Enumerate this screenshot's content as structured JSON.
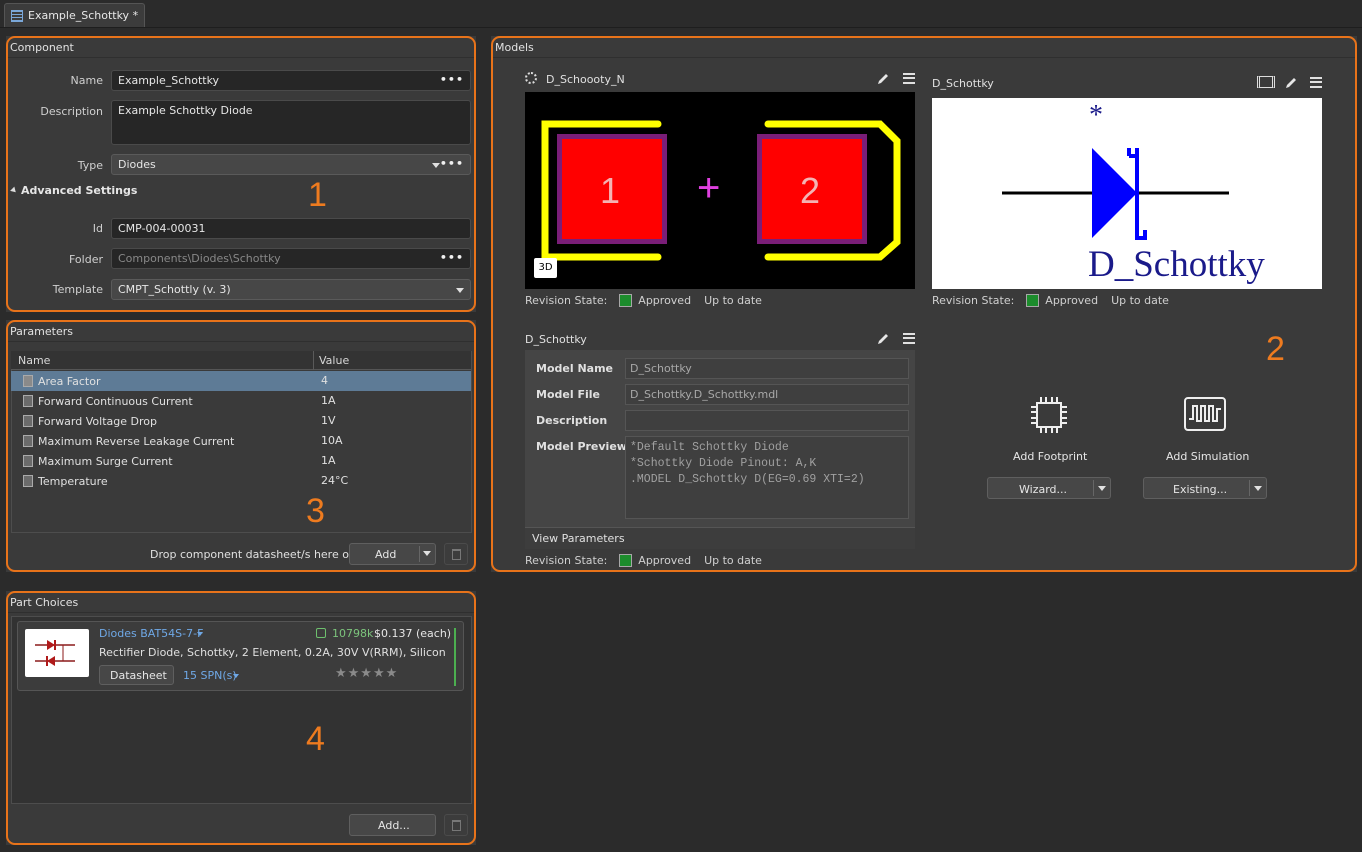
{
  "tab": {
    "title": "Example_Schottky *"
  },
  "component": {
    "title": "Component",
    "name_label": "Name",
    "name_value": "Example_Schottky",
    "description_label": "Description",
    "description_value": "Example Schottky Diode",
    "type_label": "Type",
    "type_value": "Diodes",
    "advanced_label": "Advanced Settings",
    "id_label": "Id",
    "id_value": "CMP-004-00031",
    "folder_label": "Folder",
    "folder_value": "Components\\Diodes\\Schottky",
    "template_label": "Template",
    "template_value": "CMPT_Schottly (v. 3)",
    "more": "•••"
  },
  "parameters": {
    "title": "Parameters",
    "columns": [
      "Name",
      "Value"
    ],
    "rows": [
      {
        "name": "Area Factor",
        "value": "4",
        "selected": true
      },
      {
        "name": "Forward Continuous Current",
        "value": "1A"
      },
      {
        "name": "Forward Voltage Drop",
        "value": "1V"
      },
      {
        "name": "Maximum Reverse Leakage Current",
        "value": "10A"
      },
      {
        "name": "Maximum Surge Current",
        "value": "1A"
      },
      {
        "name": "Temperature",
        "value": "24°C"
      }
    ],
    "drop_text": "Drop component datasheet/s here or",
    "add_label": "Add"
  },
  "part_choices": {
    "title": "Part Choices",
    "part_name": "Diodes BAT54S-7-F",
    "stock": "10798k",
    "price": "$0.137 (each)",
    "description": "Rectifier Diode, Schottky, 2 Element, 0.2A, 30V V(RRM), Silicon",
    "datasheet_label": "Datasheet",
    "spn_label": "15 SPN(s)",
    "rating": "★★★★★",
    "add_label": "Add..."
  },
  "models": {
    "title": "Models",
    "footprint": {
      "name": "D_Schoooty_N",
      "pad1": "1",
      "pad2": "2",
      "plus": "+",
      "badge_3d": "3D",
      "revision_label": "Revision State:",
      "state": "Approved",
      "status": "Up to date"
    },
    "symbol": {
      "name": "D_Schottky",
      "asterisk": "*",
      "symbol_label": "D_Schottky",
      "revision_label": "Revision State:",
      "state": "Approved",
      "status": "Up to date"
    },
    "simulation": {
      "name": "D_Schottky",
      "model_name_label": "Model Name",
      "model_name_value": "D_Schottky",
      "model_file_label": "Model File",
      "model_file_value": "D_Schottky.D_Schottky.mdl",
      "description_label": "Description",
      "description_value": "",
      "preview_label": "Model Preview",
      "preview_lines": [
        "*Default Schottky Diode",
        "*Schottky Diode Pinout: A,K",
        ".MODEL D_Schottky D(EG=0.69 XTI=2)"
      ],
      "view_parameters": "View Parameters",
      "revision_label": "Revision State:",
      "state": "Approved",
      "status": "Up to date"
    },
    "add_footprint": {
      "label": "Add Footprint",
      "button": "Wizard..."
    },
    "add_simulation": {
      "label": "Add Simulation",
      "button": "Existing..."
    }
  },
  "callouts": [
    "1",
    "2",
    "3",
    "4"
  ],
  "colors": {
    "accent": "#e8731a",
    "selection": "#5e7b96",
    "approved": "#1c8c2c",
    "pad": "#ff0000",
    "silk": "#ffff00",
    "symbol": "#0000ff"
  }
}
